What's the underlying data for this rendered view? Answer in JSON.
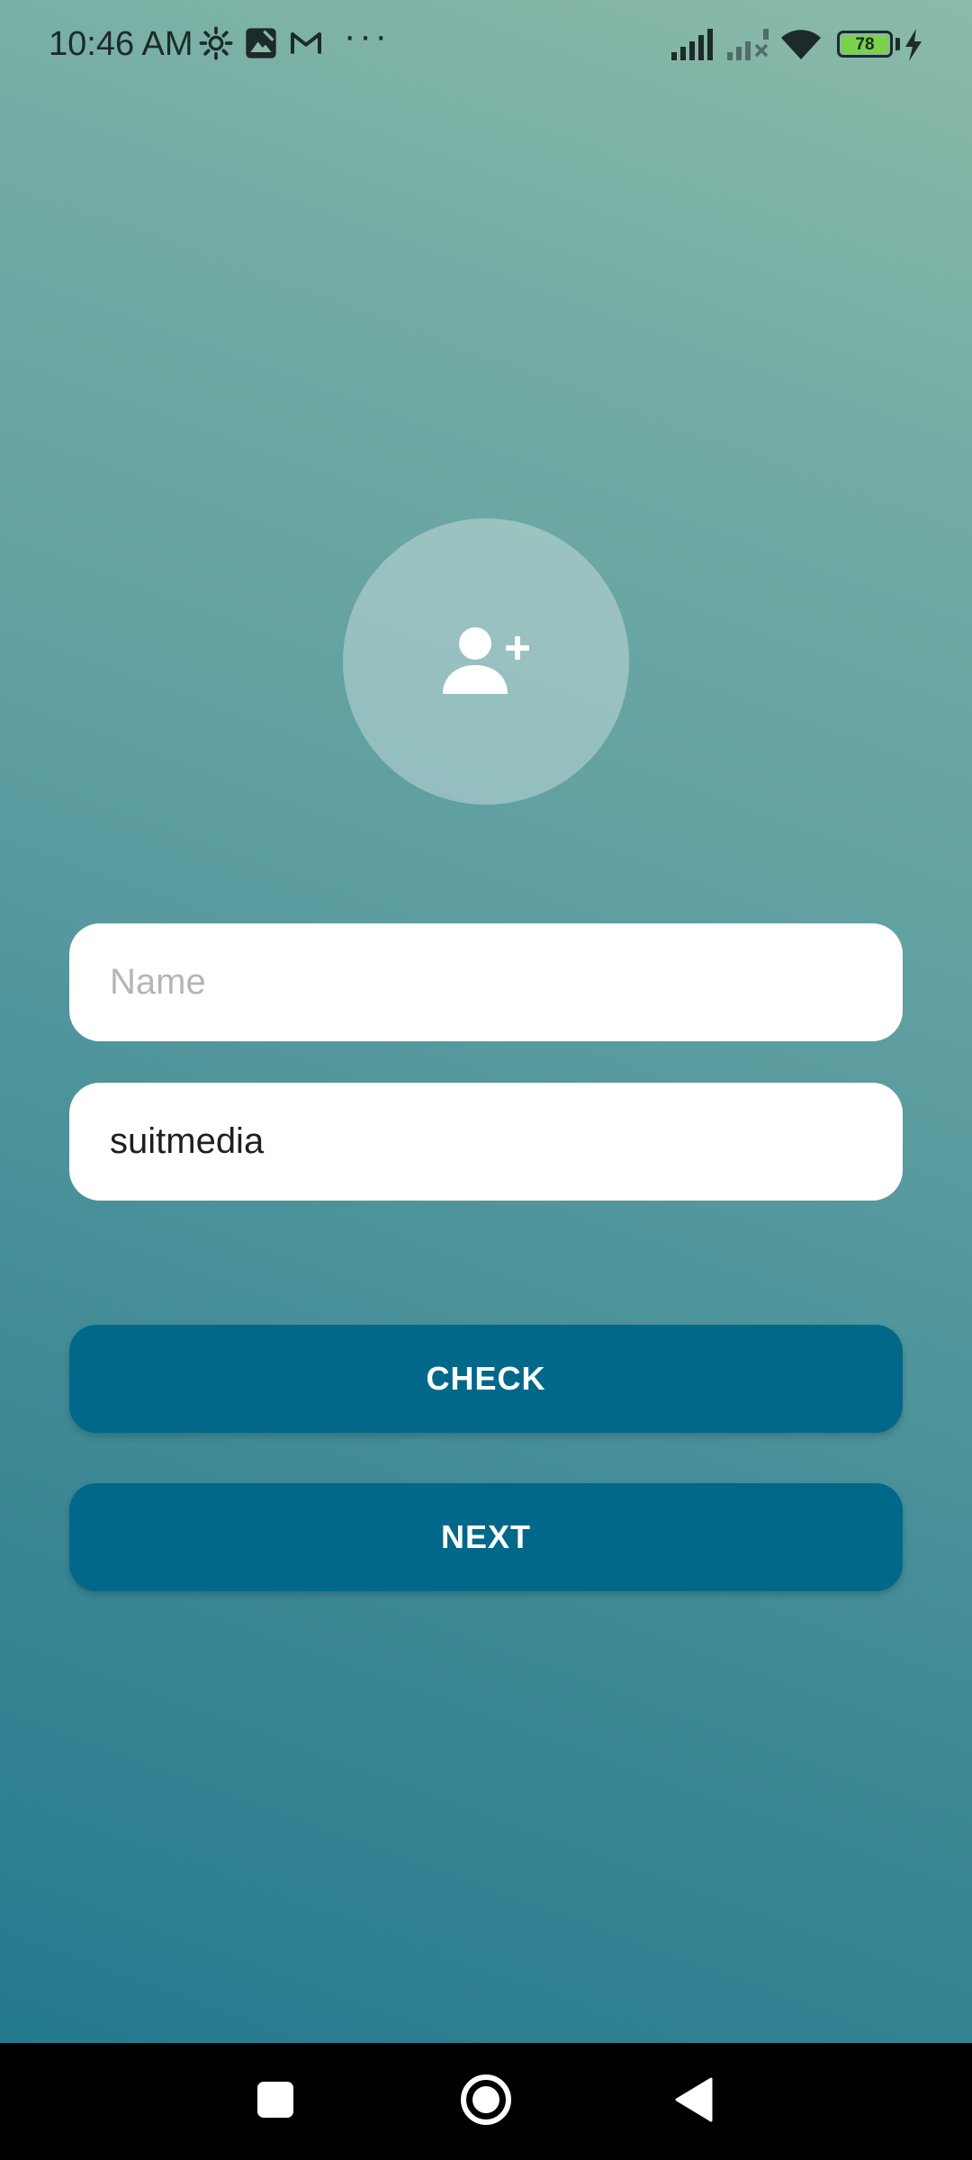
{
  "status_bar": {
    "time": "10:46 AM",
    "icons": [
      "gear-icon",
      "photo-icon",
      "gmail-icon",
      "more-icon",
      "signal-icon",
      "signal-no-sim-icon",
      "wifi-icon",
      "battery-icon",
      "charging-icon"
    ],
    "more": "···",
    "battery_level": "78"
  },
  "avatar": {
    "icon": "person-add-icon"
  },
  "form": {
    "name_placeholder": "Name",
    "name_value": "",
    "sentence_value": "suitmedia"
  },
  "buttons": {
    "check_label": "CHECK",
    "next_label": "NEXT"
  },
  "nav_bar": {
    "icons": [
      "recents-square-icon",
      "home-circle-icon",
      "back-triangle-icon"
    ]
  },
  "colors": {
    "button": "#02688a",
    "gradient_top": "#8cbaa8",
    "gradient_bottom": "#25798e",
    "battery_fill": "#7bd14a"
  }
}
